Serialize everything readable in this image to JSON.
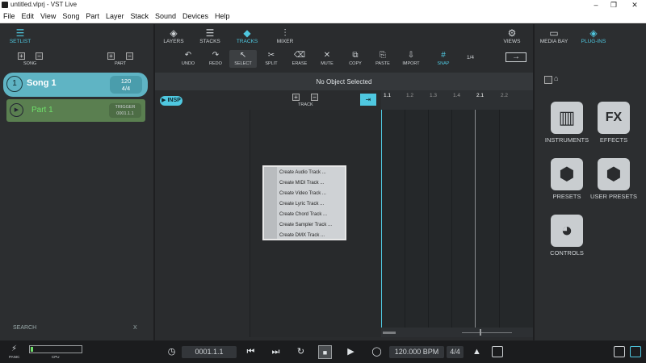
{
  "window": {
    "title": "untitled.vlprj - VST Live",
    "min": "–",
    "max": "❐",
    "close": "✕"
  },
  "menu": [
    "File",
    "Edit",
    "View",
    "Song",
    "Part",
    "Layer",
    "Stack",
    "Sound",
    "Devices",
    "Help"
  ],
  "left": {
    "setlist_label": "SETLIST",
    "song_label": "SONG",
    "part_label": "PART",
    "song": {
      "number": "1",
      "name": "Song 1",
      "tempo": "120",
      "sig": "4/4"
    },
    "part": {
      "name": "Part 1",
      "trigger_label": "TRIGGER",
      "trigger_pos": "0001.1.1"
    },
    "search_placeholder": "SEARCH",
    "search_clear": "X"
  },
  "top_tabs": [
    {
      "label": "LAYERS",
      "glyph": "◈"
    },
    {
      "label": "STACKS",
      "glyph": "☰"
    },
    {
      "label": "TRACKS",
      "glyph": "◆"
    },
    {
      "label": "MIXER",
      "glyph": "⫶"
    }
  ],
  "views_label": "VIEWS",
  "right_tabs": [
    {
      "label": "MEDIA BAY"
    },
    {
      "label": "PLUG-INS"
    }
  ],
  "tools": [
    {
      "label": "UNDO",
      "glyph": "↶"
    },
    {
      "label": "REDO",
      "glyph": "↷"
    },
    {
      "label": "SELECT",
      "glyph": "↖"
    },
    {
      "label": "SPLIT",
      "glyph": "✂"
    },
    {
      "label": "ERASE",
      "glyph": "⌫"
    },
    {
      "label": "MUTE",
      "glyph": "✕"
    },
    {
      "label": "COPY",
      "glyph": "⧉"
    },
    {
      "label": "PASTE",
      "glyph": "⎘"
    },
    {
      "label": "IMPORT",
      "glyph": "⇩"
    },
    {
      "label": "SNAP",
      "glyph": "#"
    }
  ],
  "tools_fraction": "1/4",
  "no_object": "No Object Selected",
  "insp_label": "INSP",
  "track_label": "TRACK",
  "ruler": [
    "1.1",
    "1.2",
    "1.3",
    "1.4",
    "2.1",
    "2.2"
  ],
  "context_menu": [
    "Create Audio Track ...",
    "Create MIDI Track ...",
    "Create Video Track ...",
    "Create Lyric Track ...",
    "Create Chord Track ...",
    "Create Sampler Track ...",
    "Create DMX Track ..."
  ],
  "plugins": [
    {
      "label": "INSTRUMENTS",
      "glyph": "▥"
    },
    {
      "label": "EFFECTS",
      "glyph": "FX"
    },
    {
      "label": "PRESETS",
      "glyph": "⬢"
    },
    {
      "label": "USER PRESETS",
      "glyph": "⬢"
    },
    {
      "label": "CONTROLS",
      "glyph": "◕"
    }
  ],
  "transport": {
    "panic_label": "PANIC",
    "cpu_label": "CPU",
    "position": "0001.1.1",
    "tempo": "120.000 BPM",
    "signature": "4/4"
  },
  "colors": {
    "accent": "#4fc8e0",
    "song_card": "#5fb4c4",
    "part_card": "#5a7f50",
    "part_text": "#6fe06a"
  }
}
